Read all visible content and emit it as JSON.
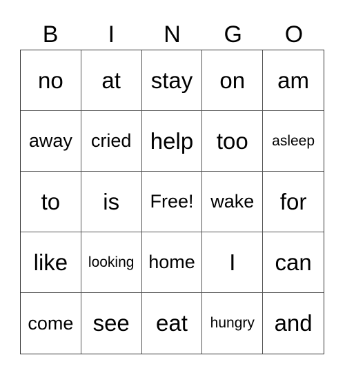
{
  "header": [
    "B",
    "I",
    "N",
    "G",
    "O"
  ],
  "cells": [
    [
      "no",
      "at",
      "stay",
      "on",
      "am"
    ],
    [
      "away",
      "cried",
      "help",
      "too",
      "asleep"
    ],
    [
      "to",
      "is",
      "Free!",
      "wake",
      "for"
    ],
    [
      "like",
      "looking",
      "home",
      "I",
      "can"
    ],
    [
      "come",
      "see",
      "eat",
      "hungry",
      "and"
    ]
  ]
}
